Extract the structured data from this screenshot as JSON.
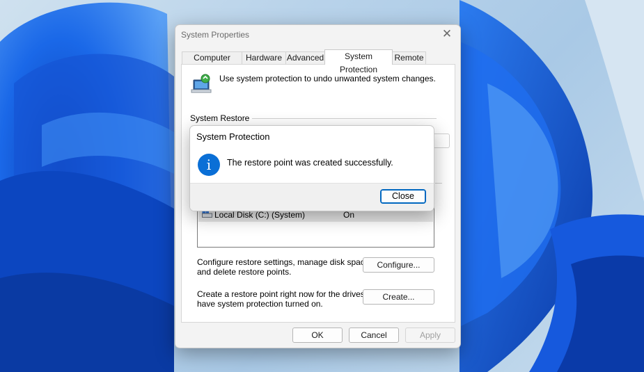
{
  "desktop": {
    "wallpaper": "windows-11-bloom-wallpaper",
    "accent": "#1f5fd8"
  },
  "window": {
    "title": "System Properties",
    "tabs": [
      "Computer Name",
      "Hardware",
      "Advanced",
      "System Protection",
      "Remote"
    ],
    "active_tab": "System Protection",
    "intro_text": "Use system protection to undo unwanted system changes.",
    "restore_group_label": "System Restore",
    "drives": [
      {
        "name": "Local Disk (C:) (System)",
        "protection": "On"
      }
    ],
    "configure_desc_line1": "Configure restore settings, manage disk space,",
    "configure_desc_line2": "and delete restore points.",
    "configure_label": "Configure...",
    "create_desc_line1": "Create a restore point right now for the drives that",
    "create_desc_line2": "have system protection turned on.",
    "create_label": "Create...",
    "ok_label": "OK",
    "cancel_label": "Cancel",
    "apply_label": "Apply"
  },
  "dialog": {
    "title": "System Protection",
    "message": "The restore point was created successfully.",
    "icon": "info-icon",
    "close_label": "Close"
  }
}
